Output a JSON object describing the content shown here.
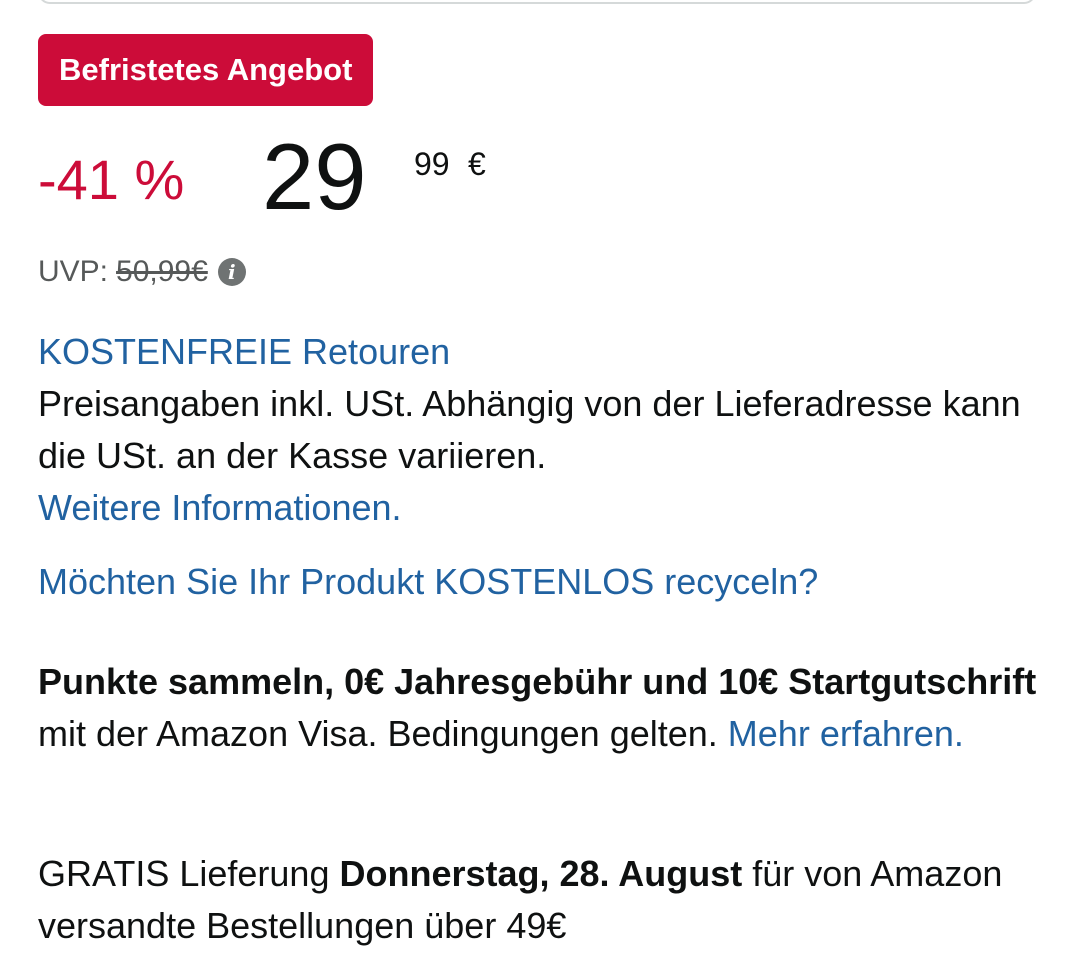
{
  "deal_badge": "Befristetes Angebot",
  "price": {
    "discount": "-41 %",
    "whole": "29",
    "fraction": "99",
    "currency": "€"
  },
  "uvp": {
    "label": "UVP:",
    "value": "50,99€",
    "info_icon": "info-icon"
  },
  "returns_link": "KOSTENFREIE Retouren",
  "tax": {
    "text": "Preisangaben inkl. USt. Abhängig von der Lieferadresse kann die USt. an der Kasse variieren.",
    "link": "Weitere Informationen."
  },
  "recycle_link": "Möchten Sie Ihr Produkt KOSTENLOS recyceln?",
  "visa": {
    "bold_text": "Punkte sammeln, 0€ Jahresgebühr und 10€ Startgutschrift",
    "text": "mit der Amazon Visa. Bedingungen gelten.",
    "link": "Mehr erfahren."
  },
  "delivery": {
    "prefix": "GRATIS Lieferung",
    "date": "Donnerstag, 28. August",
    "suffix": "für von Amazon versandte Bestellungen über 49€"
  },
  "colors": {
    "deal_red": "#cc0c39",
    "link_blue": "#2162a1",
    "muted_gray": "#565959",
    "text": "#0f1111"
  }
}
